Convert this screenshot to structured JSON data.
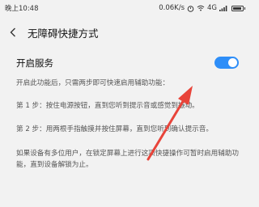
{
  "status_bar": {
    "time": "晚上10:48",
    "speed": "0.06K/s",
    "network": "4G"
  },
  "header": {
    "title": "无障碍快捷方式",
    "back_icon": "chevron-left-icon"
  },
  "service": {
    "label": "开启服务",
    "enabled": true
  },
  "description": {
    "intro": "开启此功能后，只需两步即可快速启用辅助功能：",
    "step1": "第 1 步：按住电源按钮，直到您听到提示音或感觉到振动。",
    "step2": "第 2 步：用两根手指触摸并按住屏幕，直到您听到确认提示音。",
    "note": "如果设备有多位用户，在锁定屏幕上进行这项快捷操作可暂时启用辅助功能，直到设备解锁为止。"
  },
  "colors": {
    "accent": "#2e8ef8",
    "annotation_arrow": "#e8443a"
  }
}
